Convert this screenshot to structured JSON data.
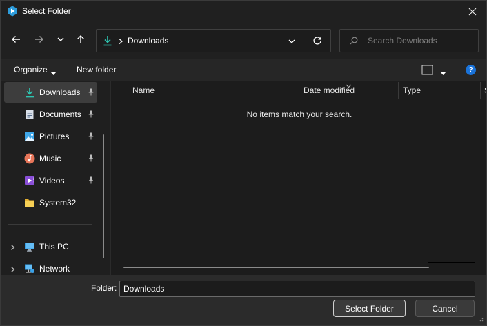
{
  "window": {
    "title": "Select Folder"
  },
  "address": {
    "location": "Downloads"
  },
  "search": {
    "placeholder": "Search Downloads"
  },
  "commands": {
    "organize": "Organize",
    "new_folder": "New folder",
    "help": "?"
  },
  "sidebar": {
    "quick_access": [
      {
        "label": "Downloads",
        "icon": "download-icon",
        "pinned": true,
        "selected": true
      },
      {
        "label": "Documents",
        "icon": "documents-icon",
        "pinned": true
      },
      {
        "label": "Pictures",
        "icon": "pictures-icon",
        "pinned": true
      },
      {
        "label": "Music",
        "icon": "music-icon",
        "pinned": true
      },
      {
        "label": "Videos",
        "icon": "videos-icon",
        "pinned": true
      },
      {
        "label": "System32",
        "icon": "folder-icon",
        "pinned": false
      }
    ],
    "locations": [
      {
        "label": "This PC",
        "icon": "this-pc-icon"
      },
      {
        "label": "Network",
        "icon": "network-icon"
      }
    ]
  },
  "columns": {
    "name": "Name",
    "date_modified": "Date modified",
    "type": "Type",
    "size": "S"
  },
  "content": {
    "empty_message": "No items match your search."
  },
  "footer": {
    "folder_label": "Folder:",
    "folder_value": "Downloads",
    "select_button": "Select Folder",
    "cancel_button": "Cancel"
  },
  "colors": {
    "accent": "#1a73d9",
    "download": "#2ec4b0",
    "folder": "#f2c94c"
  }
}
